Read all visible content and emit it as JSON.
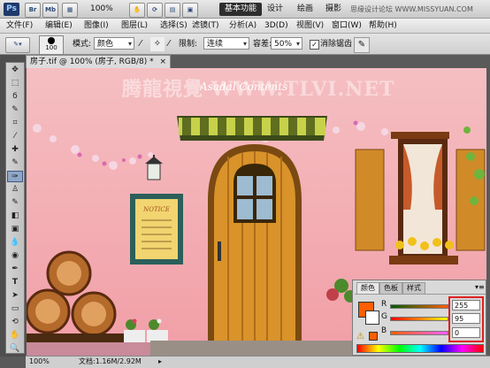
{
  "appbar": {
    "logo": "Ps",
    "br": "Br",
    "mb": "Mb",
    "zoom": "100%",
    "workspaces": [
      "基本功能",
      "设计",
      "绘画",
      "摄影"
    ],
    "watermark": "思缘设计论坛 WWW.MISSYUAN.COM"
  },
  "menubar": {
    "items": [
      "文件(F)",
      "编辑(E)",
      "图像(I)",
      "图层(L)",
      "选择(S)",
      "滤镜(T)",
      "分析(A)",
      "3D(D)",
      "视图(V)",
      "窗口(W)",
      "帮助(H)"
    ]
  },
  "options": {
    "brush_size": "100",
    "mode_label": "模式:",
    "mode_value": "颜色",
    "limit_label": "限制:",
    "limit_value": "连续",
    "tolerance_label": "容差:",
    "tolerance_value": "50%",
    "antialias_label": "消除锯齿",
    "antialias_checked": true
  },
  "document": {
    "tab_title": "房子.tif @ 100% (房子, RGB/8) *",
    "close": "×"
  },
  "canvas": {
    "watermark": "腾龍視覺 WWW.TLVI.NET",
    "brand": "Asadal Contents",
    "notice_title": "NOTICE"
  },
  "status": {
    "zoom": "100%",
    "doc_label": "文档:1.16M/2.92M"
  },
  "color_panel": {
    "tabs": [
      "颜色",
      "色板",
      "样式"
    ],
    "channels": [
      {
        "label": "R",
        "value": "255"
      },
      {
        "label": "G",
        "value": "95"
      },
      {
        "label": "B",
        "value": "0"
      }
    ],
    "foreground": "#ff5f00"
  },
  "colors": {
    "highlight": "#e02020",
    "canvas_bg": "#f3aab0"
  }
}
